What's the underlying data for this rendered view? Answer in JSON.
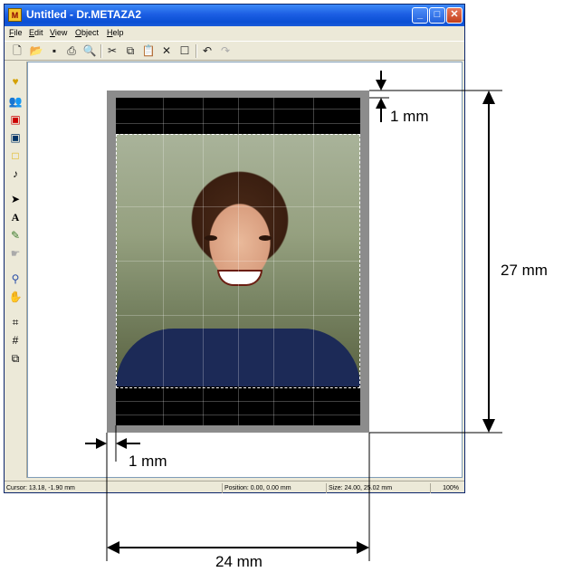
{
  "window": {
    "title": "Untitled - Dr.METAZA2",
    "app_icon_glyph": "M",
    "menus": [
      "File",
      "Edit",
      "View",
      "Object",
      "Help"
    ],
    "toolbar_icons": [
      "new-document-icon",
      "open-folder-icon",
      "save-icon",
      "print-icon",
      "print-preview-icon",
      "cut-icon",
      "copy-icon",
      "paste-icon",
      "delete-icon",
      "properties-icon",
      "undo-icon",
      "redo-icon"
    ],
    "left_tools": [
      "heart-shape-icon",
      "people-icon",
      "portrait-icon",
      "person-icon",
      "rectangle-icon",
      "music-note-icon",
      "arrow-pointer-icon",
      "text-tool-icon",
      "brush-icon",
      "hand-pointer-icon",
      "zoom-icon",
      "pan-hand-icon",
      "fit-icon",
      "grid-icon",
      "layers-icon"
    ]
  },
  "status": {
    "cursor": "Cursor: 13.18, -1.90 mm",
    "position": "Position: 0.00, 0.00 mm",
    "size": "Size: 24.00, 25.02 mm",
    "zoom": "100%"
  },
  "annotations": {
    "top_margin": "1 mm",
    "height": "27 mm",
    "left_margin": "1 mm",
    "width": "24 mm"
  }
}
